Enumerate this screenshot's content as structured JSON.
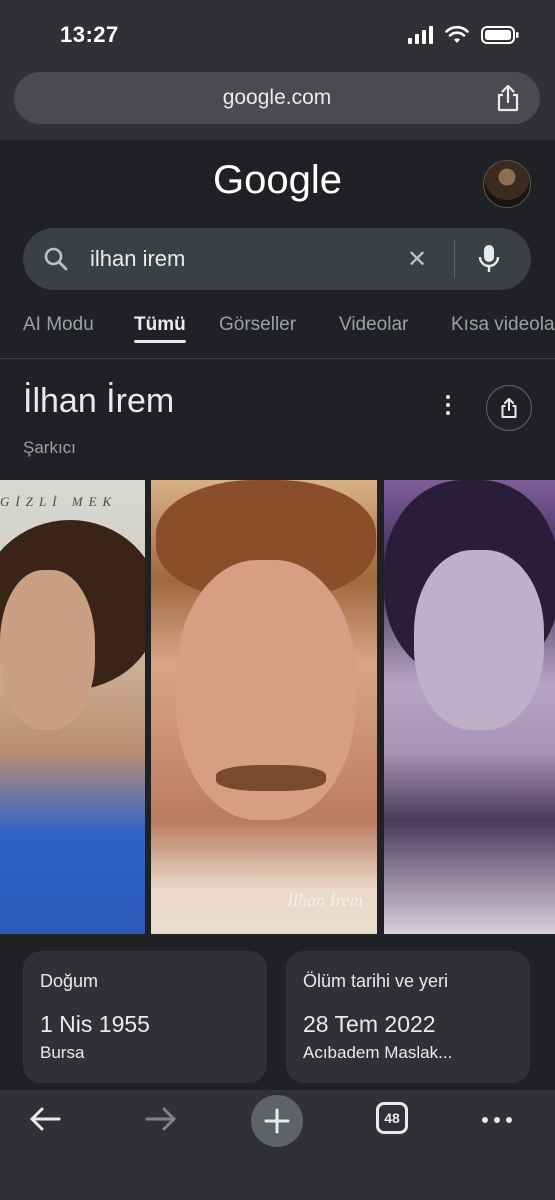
{
  "status": {
    "time": "13:27"
  },
  "browser": {
    "url": "google.com"
  },
  "google": {
    "logo": "Google",
    "search_query": "ilhan irem",
    "tabs": [
      "AI Modu",
      "Tümü",
      "Görseller",
      "Videolar",
      "Kısa videola"
    ],
    "active_tab": "Tümü"
  },
  "entity": {
    "title": "İlhan İrem",
    "subtitle": "Şarkıcı",
    "photo1_text": "GİZLİ MEK",
    "photo2_signature": "İlhan İrem"
  },
  "cards": [
    {
      "label": "Doğum",
      "value": "1 Nis 1955",
      "sub": "Bursa"
    },
    {
      "label": "Ölüm tarihi ve yeri",
      "value": "28 Tem 2022",
      "sub": "Acıbadem Maslak..."
    }
  ],
  "bottom_nav": {
    "tab_count": "48"
  },
  "icons": [
    "signal-icon",
    "wifi-icon",
    "battery-icon",
    "share-icon",
    "search-icon",
    "close-icon",
    "mic-icon",
    "more-vert-icon",
    "back-arrow-icon",
    "forward-arrow-icon",
    "plus-icon",
    "tabs-icon",
    "more-horiz-icon"
  ]
}
